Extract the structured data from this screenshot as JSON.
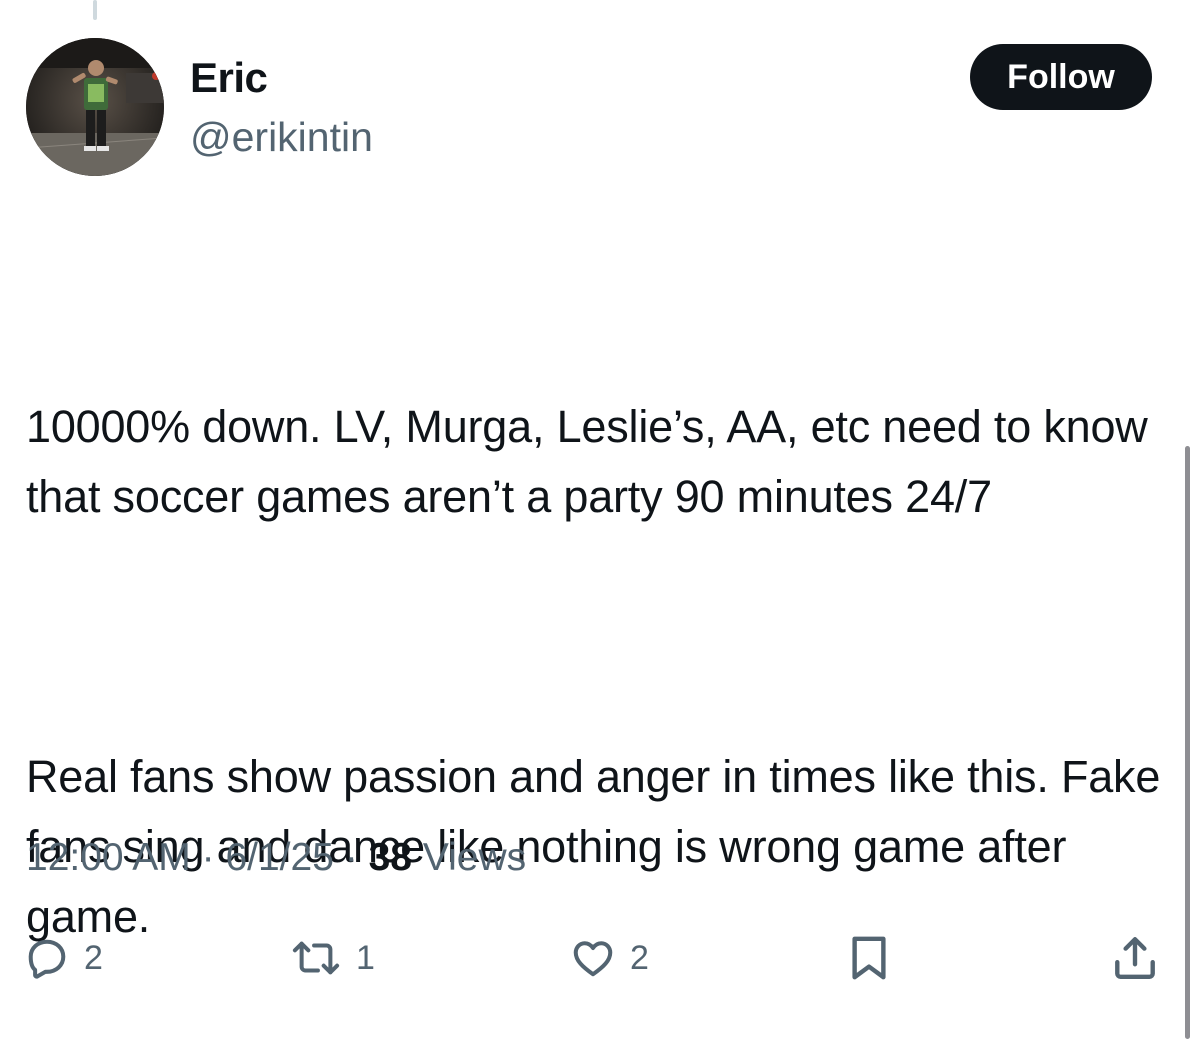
{
  "author": {
    "display_name": "Eric",
    "handle": "@erikintin"
  },
  "follow_button": {
    "label": "Follow"
  },
  "tweet": {
    "paragraphs": [
      "10000% down. LV, Murga, Leslie’s, AA, etc need to know that soccer games aren’t a party 90 minutes 24/7",
      "Real fans show passion and anger in times like this. Fake fans sing and dance like nothing is wrong game after game."
    ]
  },
  "meta": {
    "time": "12:00 AM",
    "separator": "·",
    "date": "6/1/25",
    "views_count": "38",
    "views_label": "Views"
  },
  "actions": {
    "reply": {
      "icon": "reply-icon",
      "count": "2"
    },
    "retweet": {
      "icon": "retweet-icon",
      "count": "1"
    },
    "like": {
      "icon": "heart-icon",
      "count": "2"
    },
    "bookmark": {
      "icon": "bookmark-icon"
    },
    "share": {
      "icon": "share-icon"
    }
  },
  "colors": {
    "text_primary": "#0f1419",
    "text_secondary": "#536471",
    "button_bg": "#0f1419",
    "button_text": "#ffffff"
  }
}
